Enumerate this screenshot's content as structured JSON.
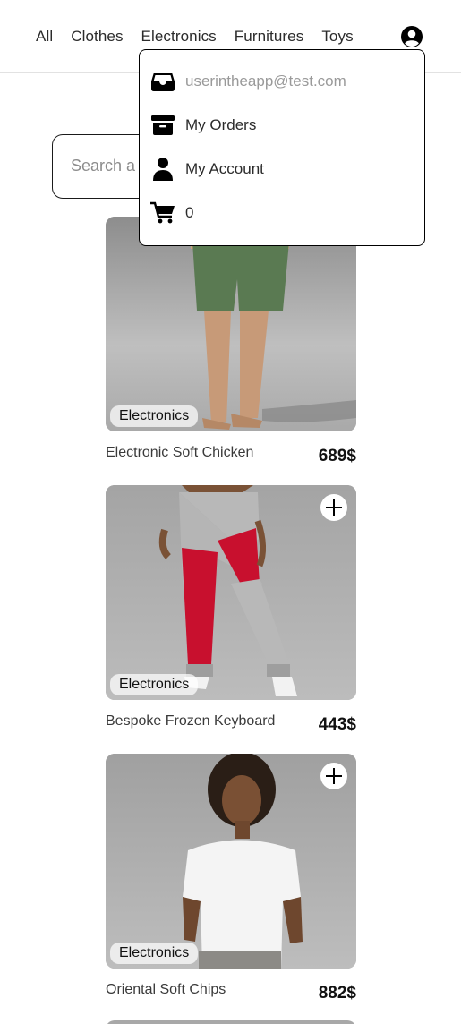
{
  "nav": {
    "links": [
      "All",
      "Clothes",
      "Electronics",
      "Furnitures",
      "Toys"
    ],
    "account_icon": "user-circle-icon"
  },
  "menu": {
    "email": "userintheapp@test.com",
    "orders": "My Orders",
    "account": "My Account",
    "cart_count": "0",
    "icons": [
      "inbox-icon",
      "archive-icon",
      "user-icon",
      "cart-icon"
    ]
  },
  "search": {
    "placeholder": "Search a product"
  },
  "products": [
    {
      "name": "Electronic Soft Chicken",
      "price": "689$",
      "category": "Electronics"
    },
    {
      "name": "Bespoke Frozen Keyboard",
      "price": "443$",
      "category": "Electronics"
    },
    {
      "name": "Oriental Soft Chips",
      "price": "882$",
      "category": "Electronics"
    }
  ],
  "colors": {
    "accent": "#000000",
    "border": "#1a1a1a",
    "muted_text": "#9a9a9a",
    "shorts_green": "#5a7a52",
    "pants_red": "#c8102e",
    "pants_grey": "#b5b5b5",
    "tshirt_white": "#f4f4f4"
  }
}
